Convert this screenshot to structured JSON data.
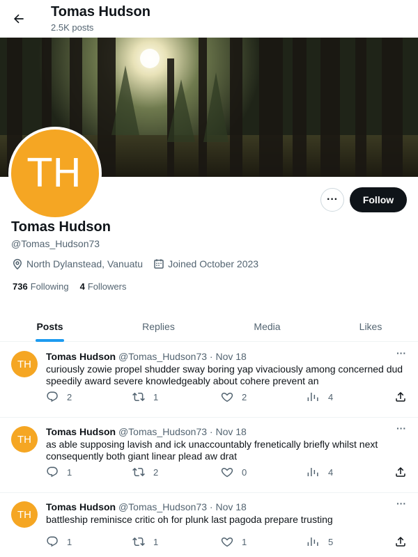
{
  "header": {
    "title": "Tomas Hudson",
    "post_count": "2.5K posts"
  },
  "profile": {
    "avatar_initials": "TH",
    "name": "Tomas Hudson",
    "handle": "@Tomas_Hudson73",
    "location": "North Dylanstead, Vanuatu",
    "joined": "Joined October 2023",
    "following_count": "736",
    "following_label": "Following",
    "followers_count": "4",
    "followers_label": "Followers",
    "more_label": "···",
    "follow_label": "Follow"
  },
  "tabs": [
    "Posts",
    "Replies",
    "Media",
    "Likes"
  ],
  "posts": [
    {
      "initials": "TH",
      "name": "Tomas Hudson",
      "meta": "@Tomas_Hudson73 · Nov 18",
      "text": "curiously zowie propel shudder sway boring yap vivaciously among concerned dud speedily award severe knowledgeably about cohere prevent an",
      "replies": "2",
      "reposts": "1",
      "likes": "2",
      "views": "4",
      "more": "···"
    },
    {
      "initials": "TH",
      "name": "Tomas Hudson",
      "meta": "@Tomas_Hudson73 · Nov 18",
      "text": "as able supposing lavish and ick unaccountably frenetically briefly whilst next consequently both giant linear plead aw drat",
      "replies": "1",
      "reposts": "2",
      "likes": "0",
      "views": "4",
      "more": "···"
    },
    {
      "initials": "TH",
      "name": "Tomas Hudson",
      "meta": "@Tomas_Hudson73 · Nov 18",
      "text": "battleship reminisce critic oh for plunk last pagoda prepare trusting",
      "replies": "1",
      "reposts": "1",
      "likes": "1",
      "views": "5",
      "more": "···"
    }
  ],
  "colors": {
    "accent": "#1d9bf0",
    "avatar": "#f5a623",
    "follow_bg": "#0f1419"
  }
}
